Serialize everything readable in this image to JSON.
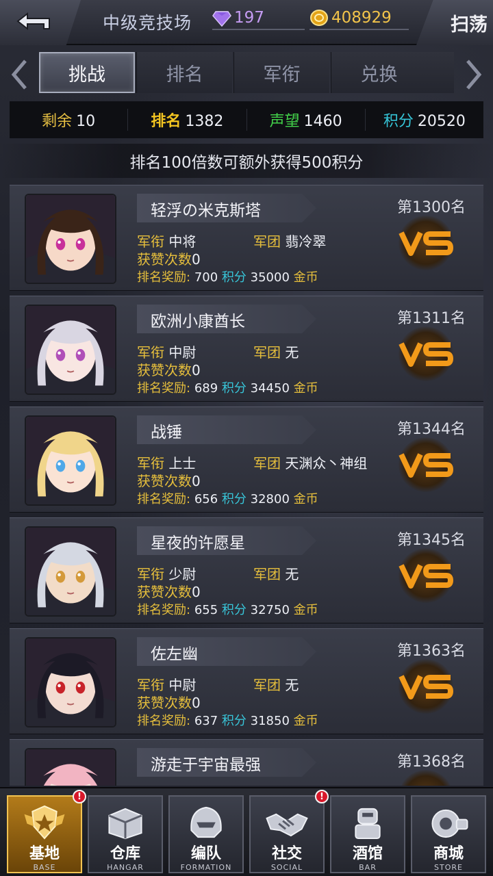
{
  "header": {
    "title": "中级竞技场",
    "gems": "197",
    "gold": "408929",
    "sweep_label": "扫荡"
  },
  "tabs": [
    {
      "label": "挑战",
      "active": true
    },
    {
      "label": "排名",
      "active": false
    },
    {
      "label": "军衔",
      "active": false
    },
    {
      "label": "兑换",
      "active": false
    }
  ],
  "stats": {
    "remaining_label": "剩余",
    "remaining_value": "10",
    "rank_label": "排名",
    "rank_value": "1382",
    "prestige_label": "声望",
    "prestige_value": "1460",
    "points_label": "积分",
    "points_value": "20520"
  },
  "notice": "排名100倍数可额外获得500积分",
  "labels": {
    "rank_title": "军衔",
    "legion": "军团",
    "likes": "获赞次数",
    "reward": "排名奖励:",
    "points_unit": "积分",
    "gold_unit": "金币",
    "vs": "VS"
  },
  "opponents": [
    {
      "name": "轻浮の米克斯塔",
      "rank": "第1300名",
      "military_rank": "中将",
      "legion": "翡冷翠",
      "likes": "0",
      "reward_points": "700",
      "reward_gold": "35000",
      "hair": "#3a2418",
      "eyes": "#c8309a",
      "skin": "#f6d9c8"
    },
    {
      "name": "欧洲小康酋长",
      "rank": "第1311名",
      "military_rank": "中尉",
      "legion": "无",
      "likes": "0",
      "reward_points": "689",
      "reward_gold": "34450",
      "hair": "#d9d6e2",
      "eyes": "#b04fb8",
      "skin": "#f8e6e2"
    },
    {
      "name": "战锤",
      "rank": "第1344名",
      "military_rank": "上士",
      "legion": "天渊众丶神组",
      "likes": "0",
      "reward_points": "656",
      "reward_gold": "32800",
      "hair": "#f0d58a",
      "eyes": "#4fa8e8",
      "skin": "#fae3d4"
    },
    {
      "name": "星夜的许愿星",
      "rank": "第1345名",
      "military_rank": "少尉",
      "legion": "无",
      "likes": "0",
      "reward_points": "655",
      "reward_gold": "32750",
      "hair": "#d4d8e2",
      "eyes": "#d49a3a",
      "skin": "#f2dcc8"
    },
    {
      "name": "佐左幽",
      "rank": "第1363名",
      "military_rank": "中尉",
      "legion": "无",
      "likes": "0",
      "reward_points": "637",
      "reward_gold": "31850",
      "hair": "#1c1a26",
      "eyes": "#c8232a",
      "skin": "#f3dcd2"
    },
    {
      "name": "游走于宇宙最强",
      "rank": "第1368名",
      "military_rank": "",
      "legion": "",
      "likes": "",
      "reward_points": "",
      "reward_gold": "",
      "hair": "#f2b4c2",
      "eyes": "#c86a8a",
      "skin": "#fae5dd"
    }
  ],
  "nav": [
    {
      "cn": "基地",
      "en": "BASE",
      "icon": "base-emblem-icon",
      "active": true,
      "badge": true
    },
    {
      "cn": "仓库",
      "en": "HANGAR",
      "icon": "hangar-crate-icon",
      "active": false,
      "badge": false
    },
    {
      "cn": "编队",
      "en": "FORMATION",
      "icon": "formation-helmet-icon",
      "active": false,
      "badge": false
    },
    {
      "cn": "社交",
      "en": "SOCIAL",
      "icon": "handshake-icon",
      "active": false,
      "badge": true
    },
    {
      "cn": "酒馆",
      "en": "BAR",
      "icon": "bar-robot-icon",
      "active": false,
      "badge": false
    },
    {
      "cn": "商城",
      "en": "STORE",
      "icon": "store-camera-icon",
      "active": false,
      "badge": false
    }
  ],
  "badge_mark": "!",
  "colors": {
    "accent_gold": "#e5be3c",
    "points_cyan": "#38c6d9",
    "prestige_green": "#43d24a",
    "vs_orange": "#f29a1a",
    "badge_red": "#d8182a"
  }
}
